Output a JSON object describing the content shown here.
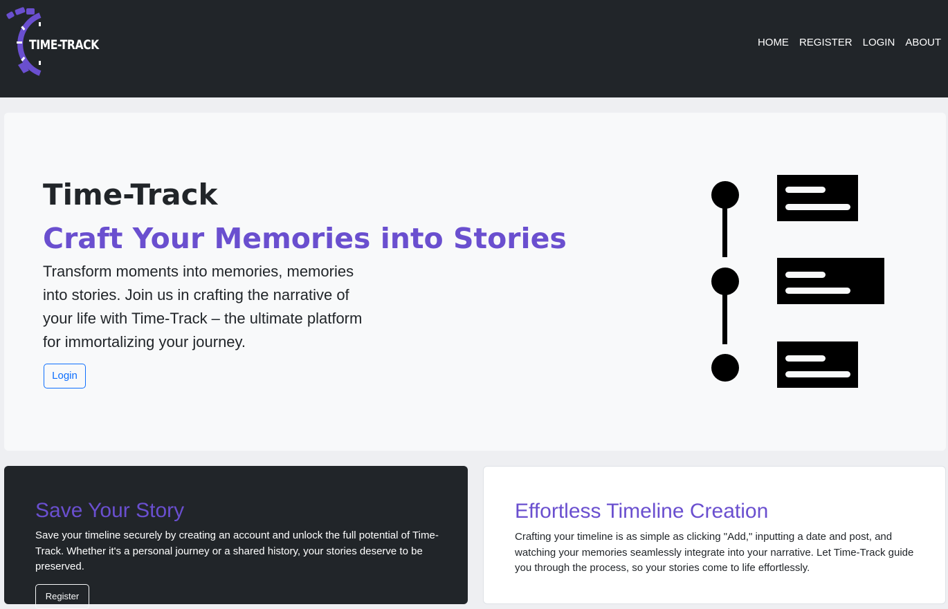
{
  "navbar": {
    "brand": "TIME-TRACK",
    "brand_icon": "stopwatch-icon",
    "brand_color": "#6a4fcf",
    "links": [
      "HOME",
      "REGISTER",
      "LOGIN",
      "ABOUT"
    ]
  },
  "hero": {
    "title": "Time-Track",
    "subtitle": "Craft Your Memories into Stories",
    "lead": "Transform moments into memories, memories into stories. Join us in crafting the narrative of your life with Time-Track – the ultimate platform for immortalizing your journey.",
    "login_button": "Login",
    "illustration_icon": "timeline-icon"
  },
  "cards": {
    "save": {
      "title": "Save Your Story",
      "text": "Save your timeline securely by creating an account and unlock the full potential of Time-Track. Whether it's a personal journey or a shared history, your stories deserve to be preserved.",
      "button": "Register"
    },
    "timeline": {
      "title": "Effortless Timeline Creation",
      "text": "Crafting your timeline is as simple as clicking \"Add,\" inputting a date and post, and watching your memories seamlessly integrate into your narrative. Let Time-Track guide you through the process, so your stories come to life effortlessly."
    }
  },
  "colors": {
    "accent": "#6a4fcf",
    "dark": "#212529",
    "light": "#f8f9fa",
    "primary": "#0d6efd",
    "page_bg": "#eeeff2"
  }
}
